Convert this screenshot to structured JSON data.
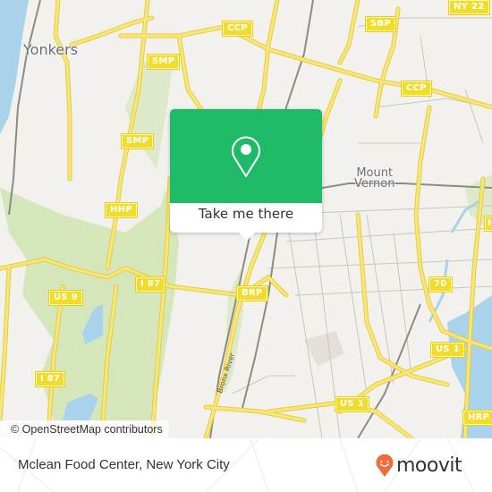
{
  "map": {
    "places": [
      {
        "id": "yonkers",
        "label": "Yonkers"
      },
      {
        "id": "mount-vernon",
        "label": "Mount\nVernon"
      }
    ],
    "shields": [
      {
        "id": "ccp-1",
        "label": "CCP"
      },
      {
        "id": "sbp",
        "label": "SBP"
      },
      {
        "id": "ny22",
        "label": "NY 22"
      },
      {
        "id": "smp-1",
        "label": "SMP"
      },
      {
        "id": "ccp-2",
        "label": "CCP"
      },
      {
        "id": "smp-2",
        "label": "SMP"
      },
      {
        "id": "hhp",
        "label": "HHP"
      },
      {
        "id": "us9",
        "label": "US 9"
      },
      {
        "id": "i87-1",
        "label": "I 87"
      },
      {
        "id": "brp",
        "label": "BRP"
      },
      {
        "id": "r70",
        "label": "70"
      },
      {
        "id": "us1-1",
        "label": "US 1"
      },
      {
        "id": "us1-2",
        "label": "US 1"
      },
      {
        "id": "i87-2",
        "label": "I 87"
      },
      {
        "id": "hrp",
        "label": "HRP"
      },
      {
        "id": "h-edge",
        "label": "H"
      }
    ],
    "river_label": "Bronx River",
    "attribution": "© OpenStreetMap contributors"
  },
  "popup": {
    "label": "Take me there",
    "icon": "map-pin-icon"
  },
  "footer": {
    "title": "Mclean Food Center, New York City",
    "brand": "moovit",
    "brand_icon": "moovit-logo-icon"
  },
  "colors": {
    "popup_green": "#1fba68",
    "moovit_orange": "#f26b3a",
    "road_yellow": "#f5dd5a",
    "water": "#a9d3ea",
    "park": "#d5e6bb"
  }
}
